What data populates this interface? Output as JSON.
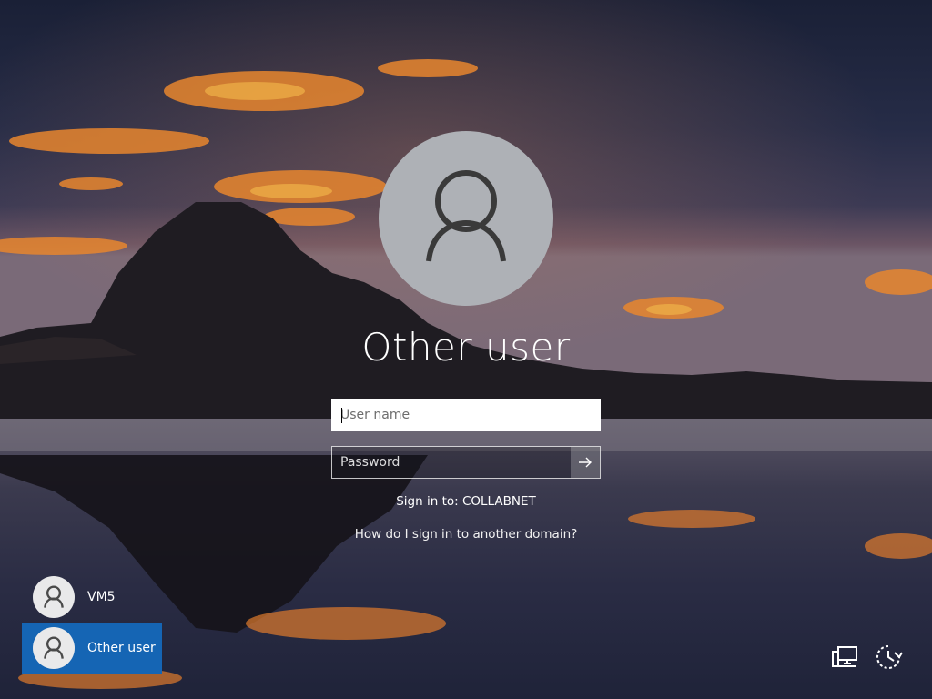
{
  "sign_in": {
    "title": "Other user",
    "username_placeholder": "User name",
    "username_value": "",
    "password_placeholder": "Password",
    "submit_icon": "arrow-right-icon",
    "sign_in_to": "Sign in to: COLLABNET",
    "help_link": "How do I sign in to another domain?"
  },
  "user_list": [
    {
      "name": "VM5",
      "selected": false,
      "icon": "user-icon"
    },
    {
      "name": "Other user",
      "selected": true,
      "icon": "user-icon"
    }
  ],
  "system_buttons": [
    {
      "icon": "network-icon"
    },
    {
      "icon": "ease-of-access-icon"
    }
  ],
  "colors": {
    "selected_tile": "#1565b4",
    "avatar_bg": "#aeb1b6"
  }
}
